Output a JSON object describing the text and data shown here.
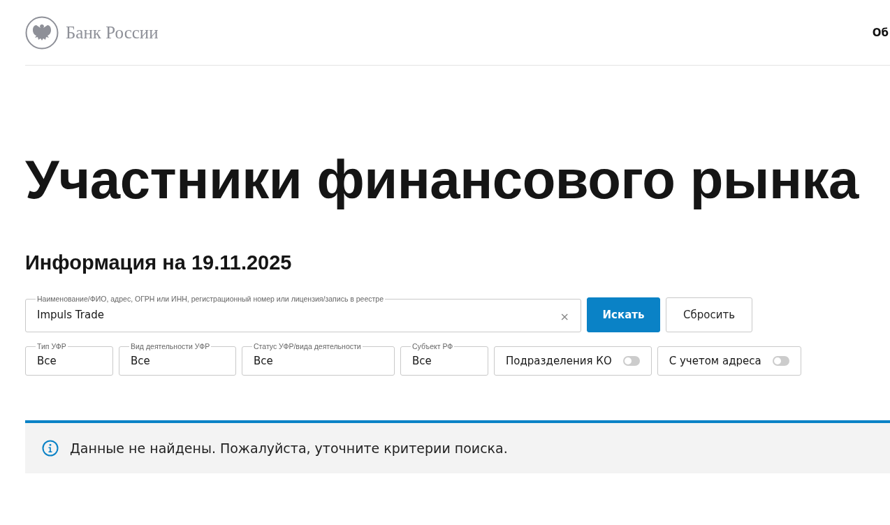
{
  "header": {
    "logo_text": "Банк России",
    "nav_partial": "Об"
  },
  "title": "Участники финансового рынка",
  "subtitle": "Информация на 19.11.2025",
  "search": {
    "label": "Наименование/ФИО, адрес, ОГРН или ИНН, регистрационный номер или лицензия/запись в реестре",
    "value": "Impuls Trade",
    "clear": "×"
  },
  "buttons": [
    {
      "kind": "primary",
      "label": "Искать"
    },
    {
      "kind": "secondary",
      "label": "Сбросить"
    }
  ],
  "filters": [
    {
      "kind": "select",
      "label": "Тип УФР",
      "value": "Все"
    },
    {
      "kind": "select",
      "label": "Вид деятельности УФР",
      "value": "Все"
    },
    {
      "kind": "select",
      "label": "Статус УФР/вида деятельности",
      "value": "Все"
    },
    {
      "kind": "select",
      "label": "Субъект РФ",
      "value": "Все"
    },
    {
      "kind": "toggle",
      "label": "Подразделения КО",
      "on": false
    },
    {
      "kind": "toggle",
      "label": "С учетом адреса",
      "on": false
    }
  ],
  "notice": {
    "text": "Данные не найдены. Пожалуйста, уточните критерии поиска."
  }
}
